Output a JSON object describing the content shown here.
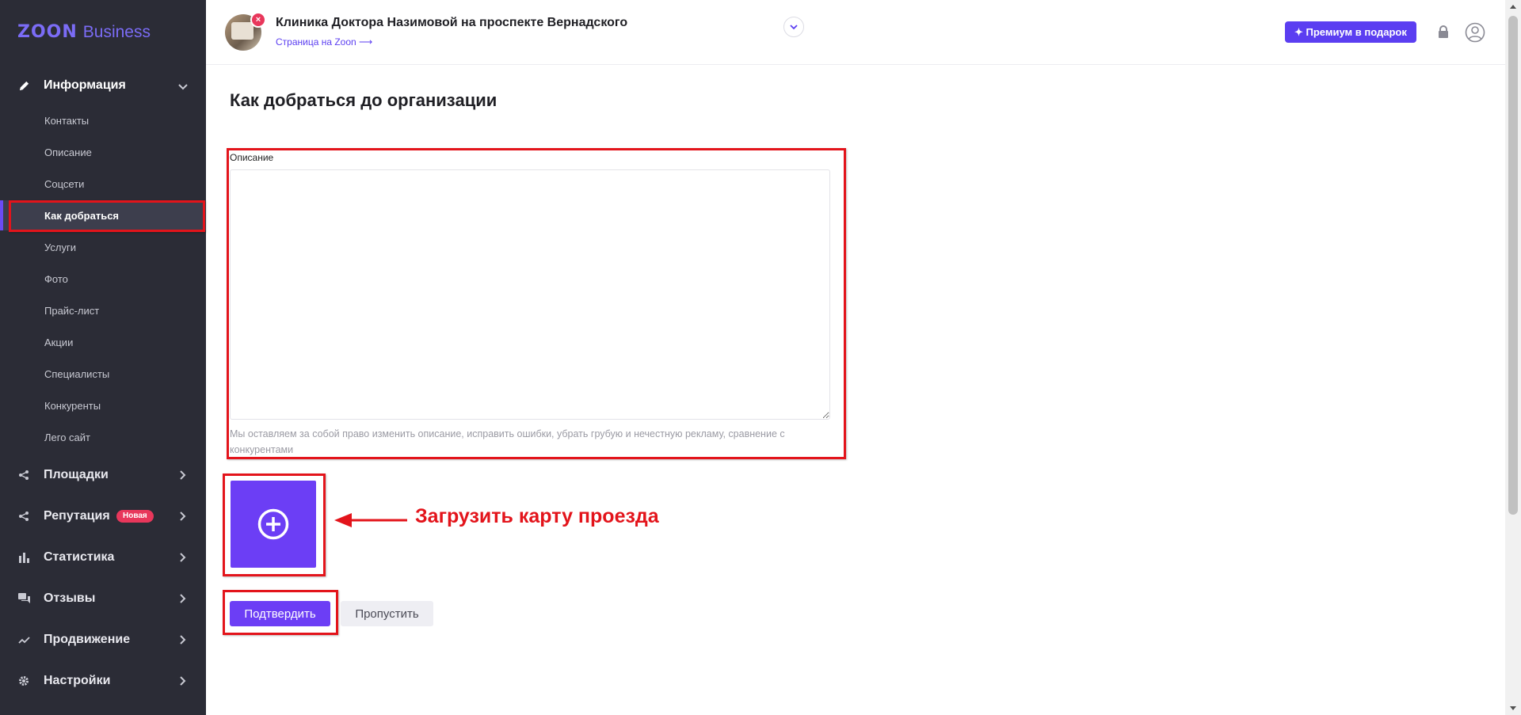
{
  "brand": {
    "zoon": "ZOON",
    "business": "Business"
  },
  "sidebar": {
    "info_section": {
      "label": "Информация"
    },
    "info_items": [
      {
        "label": "Контакты"
      },
      {
        "label": "Описание"
      },
      {
        "label": "Соцсети"
      },
      {
        "label": "Как добраться"
      },
      {
        "label": "Услуги"
      },
      {
        "label": "Фото"
      },
      {
        "label": "Прайс-лист"
      },
      {
        "label": "Акции"
      },
      {
        "label": "Специалисты"
      },
      {
        "label": "Конкуренты"
      },
      {
        "label": "Лего сайт"
      }
    ],
    "sections": [
      {
        "label": "Площадки",
        "icon": "share-icon"
      },
      {
        "label": "Репутация",
        "icon": "share-icon",
        "badge": "Новая"
      },
      {
        "label": "Статистика",
        "icon": "bar-chart-icon"
      },
      {
        "label": "Отзывы",
        "icon": "chat-icon"
      },
      {
        "label": "Продвижение",
        "icon": "trend-icon"
      },
      {
        "label": "Настройки",
        "icon": "gear-icon"
      }
    ]
  },
  "header": {
    "org_name": "Клиника Доктора Назимовой на проспекте Вернадского",
    "org_link": "Страница на Zoon ⟶",
    "premium_label": "Премиум в подарок"
  },
  "main": {
    "title": "Как добраться до организации",
    "description_label": "Описание",
    "description_value": "",
    "description_hint": "Мы оставляем за собой право изменить описание, исправить ошибки, убрать грубую и нечестную рекламу, сравнение с конкурентами",
    "confirm_label": "Подтвердить",
    "skip_label": "Пропустить"
  },
  "annotation": {
    "text": "Загрузить карту проезда"
  },
  "colors": {
    "accent": "#6c3ef5",
    "sidebar_bg": "#2b2c36",
    "annotation_red": "#e3141b",
    "badge_red": "#e8375b"
  }
}
